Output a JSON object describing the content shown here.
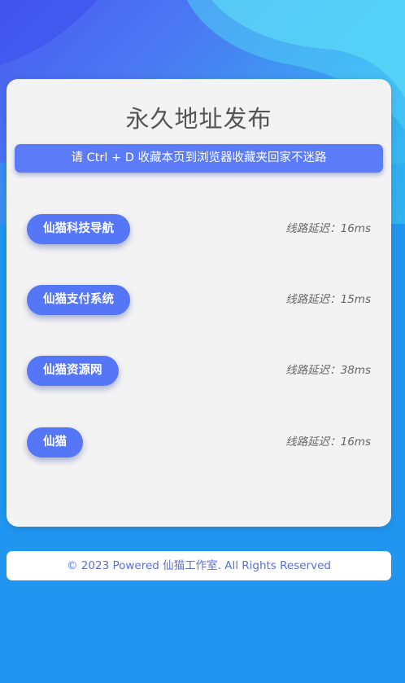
{
  "page": {
    "title": "永久地址发布",
    "notice": "请 Ctrl + D 收藏本页到浏览器收藏夹回家不迷路"
  },
  "routes": [
    {
      "name": "仙猫科技导航",
      "latency": "线路延迟：16ms"
    },
    {
      "name": "仙猫支付系统",
      "latency": "线路延迟：15ms"
    },
    {
      "name": "仙猫资源网",
      "latency": "线路延迟：38ms"
    },
    {
      "name": "仙猫",
      "latency": "线路延迟：16ms"
    }
  ],
  "footer": {
    "text": "© 2023 Powered 仙猫工作室. All Rights Reserved"
  },
  "colors": {
    "accent": "#5576f6",
    "background": "#2196f0",
    "card": "#f3f3f3",
    "footer_text": "#5a6fd6"
  }
}
